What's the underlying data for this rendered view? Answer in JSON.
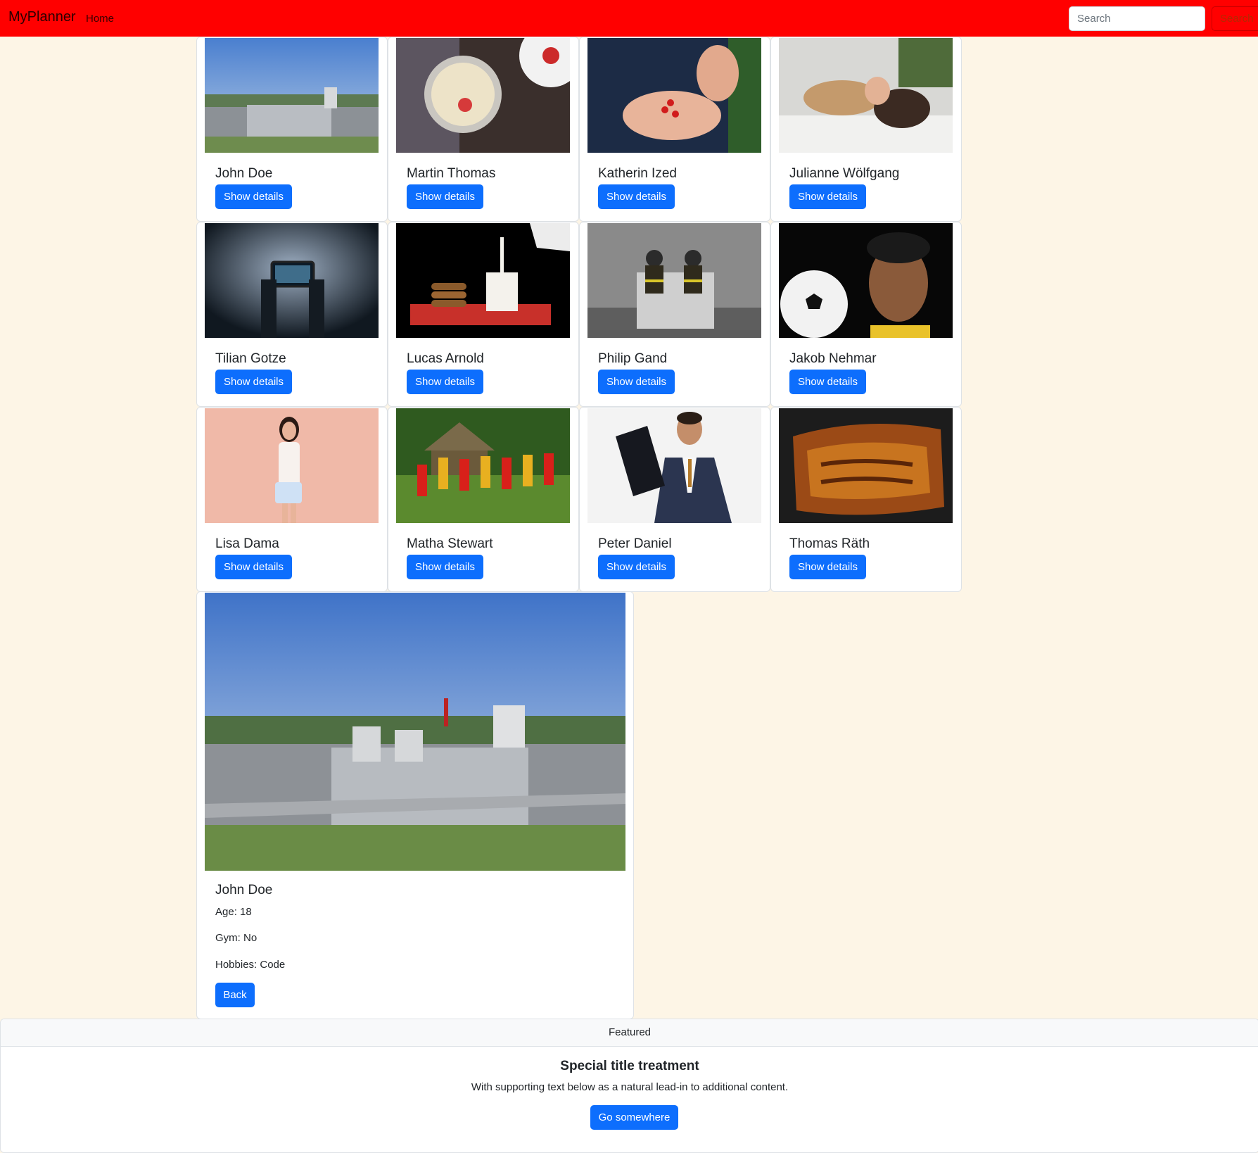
{
  "navbar": {
    "brand": "MyPlanner",
    "home": "Home",
    "search_placeholder": "Search",
    "search_button": "Search",
    "bg_color": "#ff0000"
  },
  "cards": [
    {
      "name": "John Doe",
      "button": "Show details",
      "image": "industrial-plant-photo"
    },
    {
      "name": "Martin Thomas",
      "button": "Show details",
      "image": "yogurt-bowl-photo"
    },
    {
      "name": "Katherin Ized",
      "button": "Show details",
      "image": "berries-in-hand-photo"
    },
    {
      "name": "Julianne Wölfgang",
      "button": "Show details",
      "image": "woman-with-dog-photo"
    },
    {
      "name": "Tilian Gotze",
      "button": "Show details",
      "image": "phone-camera-photo"
    },
    {
      "name": "Lucas Arnold",
      "button": "Show details",
      "image": "milk-and-cookies-photo"
    },
    {
      "name": "Philip Gand",
      "button": "Show details",
      "image": "firefighters-photo"
    },
    {
      "name": "Jakob Nehmar",
      "button": "Show details",
      "image": "boy-with-football-photo"
    },
    {
      "name": "Lisa Dama",
      "button": "Show details",
      "image": "woman-with-handbag-photo"
    },
    {
      "name": "Matha Stewart",
      "button": "Show details",
      "image": "folk-dancers-photo"
    },
    {
      "name": "Peter Daniel",
      "button": "Show details",
      "image": "businessman-photo"
    },
    {
      "name": "Thomas Räth",
      "button": "Show details",
      "image": "grilled-meat-photo"
    }
  ],
  "detail": {
    "name": "John Doe",
    "age": "Age: 18",
    "gym": "Gym: No",
    "hobbies": "Hobbies: Code",
    "back": "Back",
    "image": "industrial-plant-photo"
  },
  "featured": {
    "header": "Featured",
    "title": "Special title treatment",
    "text": "With supporting text below as a natural lead-in to additional content.",
    "button": "Go somewhere"
  },
  "colors": {
    "page_bg": "#fdf5e6",
    "primary": "#0d6efd"
  }
}
